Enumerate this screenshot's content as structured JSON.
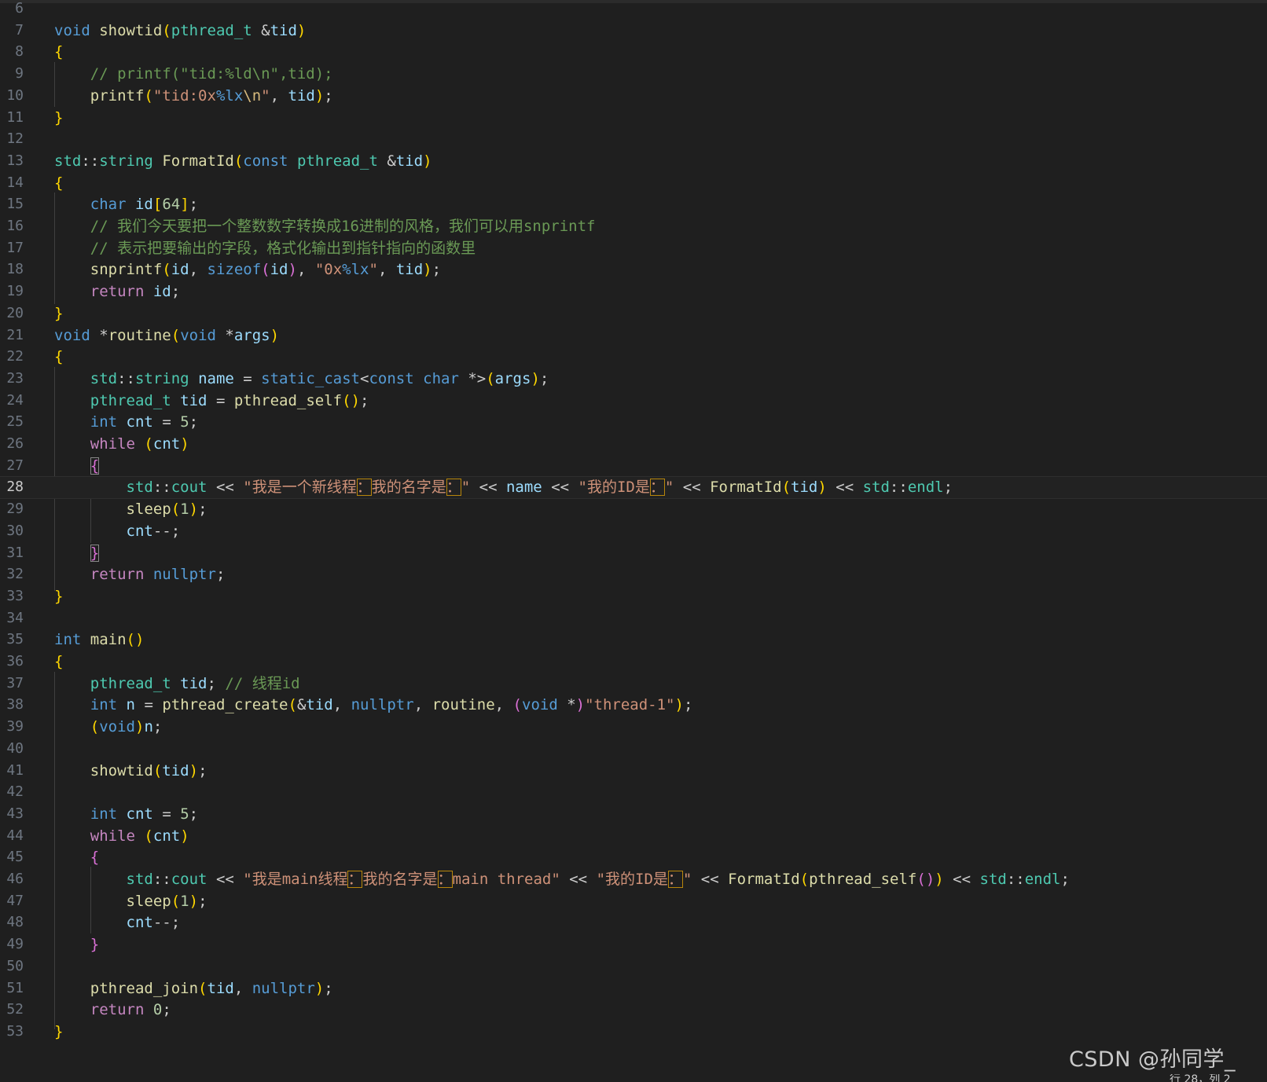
{
  "editor": {
    "current_line": 28,
    "lines": [
      {
        "n": "6",
        "code": ""
      },
      {
        "n": "7",
        "code": "void showtid(pthread_t &tid)"
      },
      {
        "n": "8",
        "code": "{"
      },
      {
        "n": "9",
        "code": "    // printf(\"tid:%ld\\n\",tid);"
      },
      {
        "n": "10",
        "code": "    printf(\"tid:0x%lx\\n\", tid);"
      },
      {
        "n": "11",
        "code": "}"
      },
      {
        "n": "12",
        "code": ""
      },
      {
        "n": "13",
        "code": "std::string FormatId(const pthread_t &tid)"
      },
      {
        "n": "14",
        "code": "{"
      },
      {
        "n": "15",
        "code": "    char id[64];"
      },
      {
        "n": "16",
        "code": "    // 我们今天要把一个整数数字转换成16进制的风格，我们可以用snprintf"
      },
      {
        "n": "17",
        "code": "    // 表示把要输出的字段，格式化输出到指针指向的函数里"
      },
      {
        "n": "18",
        "code": "    snprintf(id, sizeof(id), \"0x%lx\", tid);"
      },
      {
        "n": "19",
        "code": "    return id;"
      },
      {
        "n": "20",
        "code": "}"
      },
      {
        "n": "21",
        "code": "void *routine(void *args)"
      },
      {
        "n": "22",
        "code": "{"
      },
      {
        "n": "23",
        "code": "    std::string name = static_cast<const char *>(args);"
      },
      {
        "n": "24",
        "code": "    pthread_t tid = pthread_self();"
      },
      {
        "n": "25",
        "code": "    int cnt = 5;"
      },
      {
        "n": "26",
        "code": "    while (cnt)"
      },
      {
        "n": "27",
        "code": "    {"
      },
      {
        "n": "28",
        "code": "        std::cout << \"我是一个新线程：我的名字是：\" << name << \"我的ID是：\" << FormatId(tid) << std::endl;"
      },
      {
        "n": "29",
        "code": "        sleep(1);"
      },
      {
        "n": "30",
        "code": "        cnt--;"
      },
      {
        "n": "31",
        "code": "    }"
      },
      {
        "n": "32",
        "code": "    return nullptr;"
      },
      {
        "n": "33",
        "code": "}"
      },
      {
        "n": "34",
        "code": ""
      },
      {
        "n": "35",
        "code": "int main()"
      },
      {
        "n": "36",
        "code": "{"
      },
      {
        "n": "37",
        "code": "    pthread_t tid; // 线程id"
      },
      {
        "n": "38",
        "code": "    int n = pthread_create(&tid, nullptr, routine, (void *)\"thread-1\");"
      },
      {
        "n": "39",
        "code": "    (void)n;"
      },
      {
        "n": "40",
        "code": ""
      },
      {
        "n": "41",
        "code": "    showtid(tid);"
      },
      {
        "n": "42",
        "code": ""
      },
      {
        "n": "43",
        "code": "    int cnt = 5;"
      },
      {
        "n": "44",
        "code": "    while (cnt)"
      },
      {
        "n": "45",
        "code": "    {"
      },
      {
        "n": "46",
        "code": "        std::cout << \"我是main线程：我的名字是：main thread\" << \"我的ID是：\" << FormatId(pthread_self()) << std::endl;"
      },
      {
        "n": "47",
        "code": "        sleep(1);"
      },
      {
        "n": "48",
        "code": "        cnt--;"
      },
      {
        "n": "49",
        "code": "    }"
      },
      {
        "n": "50",
        "code": ""
      },
      {
        "n": "51",
        "code": "    pthread_join(tid, nullptr);"
      },
      {
        "n": "52",
        "code": "    return 0;"
      },
      {
        "n": "53",
        "code": "}"
      }
    ]
  },
  "watermark": "CSDN @孙同学_",
  "statusbar": {
    "position": "行 28，列 2"
  },
  "colors": {
    "background": "#1f1f1f",
    "keyword": "#569cd6",
    "control": "#c586c0",
    "type": "#4ec9b0",
    "function": "#dcdcaa",
    "variable": "#9cdcfe",
    "string": "#ce9178",
    "number": "#b5cea8",
    "comment": "#6a9955",
    "bracket_gold": "#ffd700",
    "bracket_orchid": "#da70d6",
    "bracket_blue": "#179fff"
  }
}
